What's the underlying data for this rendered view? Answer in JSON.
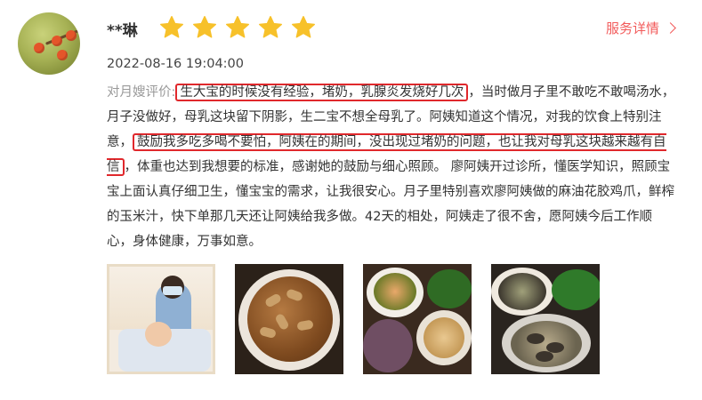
{
  "reviewer": {
    "name": "**琳",
    "rating": 5,
    "avatar_icon": "avatar-photo-red-berries"
  },
  "header": {
    "details_label": "服务详情",
    "details_icon": "chevron-right-icon",
    "accent_color": "#f25a5a",
    "star_color": "#f7c12a"
  },
  "review": {
    "date": "2022-08-16 19:04:00",
    "label": "对月嫂评价:",
    "segments": [
      {
        "text": "生大宝的时候没有经验，堵奶，乳腺炎发烧好几次",
        "highlight": true
      },
      {
        "text": "，当时做月子里不敢吃不敢喝汤水，月子没做好，母乳这块留下阴影，生二宝不想全母乳了。阿姨知道这个情况，对我的饮食上特别注意，",
        "highlight": false
      },
      {
        "text": "鼓励我多吃多喝不要怕，阿姨在的期间，没出现过堵奶的问题，也让我对母乳这块越来越有自信",
        "highlight": true
      },
      {
        "text": "，体重也达到我想要的标准，感谢她的鼓励与细心照顾。 廖阿姨开过诊所，懂医学知识，照顾宝宝上面认真仔细卫生，懂宝宝的需求，让我很安心。月子里特别喜欢廖阿姨做的麻油花胶鸡爪，鲜榨的玉米汁，快下单那几天还让阿姨给我多做。42天的相处，阿姨走了很不舍，愿阿姨今后工作顺心，身体健康，万事如意。",
        "highlight": false
      }
    ],
    "highlight_color": "#e0282c"
  },
  "photos": [
    {
      "name": "photo-nanny-with-baby"
    },
    {
      "name": "photo-braised-dish"
    },
    {
      "name": "photo-table-dishes"
    },
    {
      "name": "photo-soup-and-dishes"
    }
  ]
}
